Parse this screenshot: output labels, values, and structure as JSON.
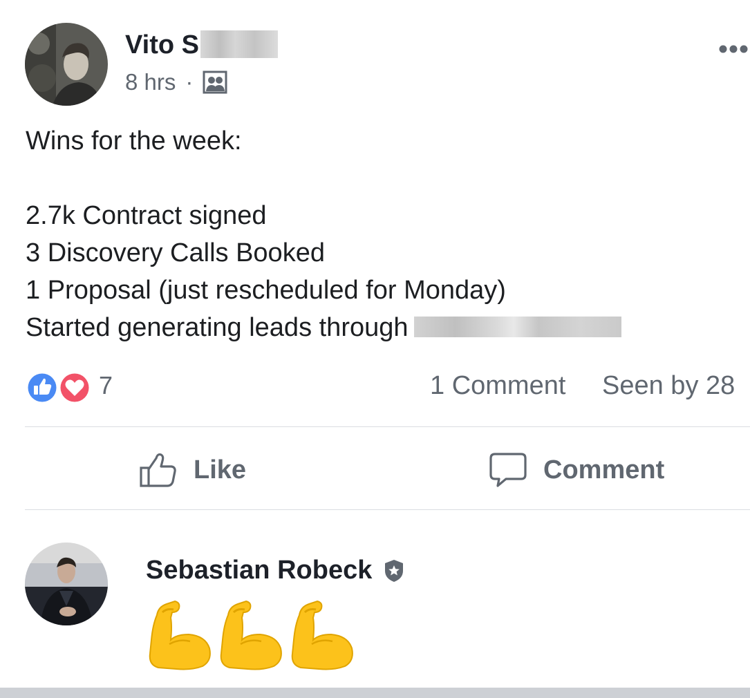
{
  "post": {
    "author": {
      "name": "Vito S",
      "name_redacted": true
    },
    "time": "8 hrs",
    "separator": "·",
    "audience_icon": "group-audience-icon",
    "more_icon": "more-dots-icon",
    "body_lines": [
      "Wins for the  week:",
      "",
      "2.7k Contract signed",
      "3 Discovery Calls Booked",
      "1 Proposal (just rescheduled for Monday)",
      "Started generating leads through"
    ],
    "body_last_line_redacted": true
  },
  "stats": {
    "reactions": [
      "like",
      "love"
    ],
    "reaction_count": "7",
    "comments": "1 Comment",
    "seen_by": "Seen by 28"
  },
  "actions": {
    "like_label": "Like",
    "comment_label": "Comment"
  },
  "comment": {
    "author": "Sebastian Robeck",
    "badge_icon": "admin-badge-icon",
    "content_emoji": [
      "flexed-biceps",
      "flexed-biceps",
      "flexed-biceps"
    ]
  },
  "colors": {
    "like_blue": "#4a8af4",
    "love_red": "#f25268",
    "meta_gray": "#606770",
    "text": "#1c1e21",
    "divider": "#dadde1",
    "emoji_yellow": "#fcc21b"
  }
}
